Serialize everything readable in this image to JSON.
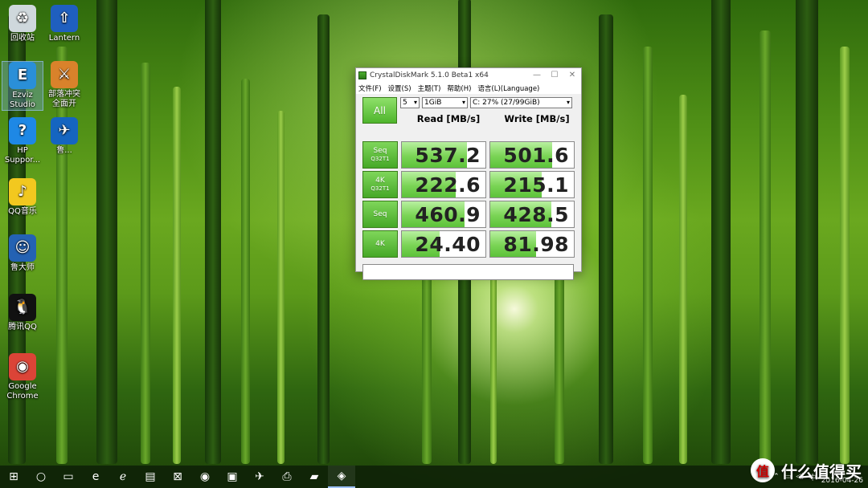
{
  "desktop": {
    "icons": [
      {
        "label": "回收站",
        "icon": "recycle-bin-icon",
        "color": "#cfd8dc"
      },
      {
        "label": "Lantern",
        "icon": "lantern-icon",
        "color": "#1f5fbf"
      },
      {
        "label": "Ezviz Studio",
        "icon": "ezviz-icon",
        "color": "#2a8fd8"
      },
      {
        "label": "部落冲突 全面开",
        "icon": "clash-icon",
        "color": "#d9822b"
      },
      {
        "label": "HP Suppor...",
        "icon": "help-icon",
        "color": "#1e88e5"
      },
      {
        "label": "鲁...",
        "icon": "bird-icon",
        "color": "#1565c0"
      },
      {
        "label": "QQ音乐",
        "icon": "qqmusic-icon",
        "color": "#f2c81f"
      },
      {
        "label": "鲁大师",
        "icon": "ludashi-icon",
        "color": "#2462b3"
      },
      {
        "label": "腾讯QQ",
        "icon": "qq-icon",
        "color": "#111111"
      },
      {
        "label": "Google Chrome",
        "icon": "chrome-icon",
        "color": "#db4437"
      }
    ]
  },
  "window": {
    "title": "CrystalDiskMark 5.1.0 Beta1 x64",
    "controls": {
      "minimize": "—",
      "maximize": "☐",
      "close": "✕"
    },
    "menu": [
      "文件(F)",
      "设置(S)",
      "主题(T)",
      "帮助(H)",
      "语言(L)(Language)"
    ],
    "all_label": "All",
    "count": "5",
    "size": "1GiB",
    "drive": "C: 27% (27/99GiB)",
    "read_header": "Read [MB/s]",
    "write_header": "Write [MB/s]",
    "rows": [
      {
        "label": "Seq",
        "sub": "Q32T1",
        "read": "537.2",
        "write": "501.6",
        "read_pct": 0.78,
        "write_pct": 0.74
      },
      {
        "label": "4K",
        "sub": "Q32T1",
        "read": "222.6",
        "write": "215.1",
        "read_pct": 0.64,
        "write_pct": 0.62
      },
      {
        "label": "Seq",
        "sub": "",
        "read": "460.9",
        "write": "428.5",
        "read_pct": 0.75,
        "write_pct": 0.73
      },
      {
        "label": "4K",
        "sub": "",
        "read": "24.40",
        "write": "81.98",
        "read_pct": 0.45,
        "write_pct": 0.55
      }
    ]
  },
  "taskbar": {
    "items": [
      "windows-start-icon",
      "cortana-icon",
      "task-view-icon",
      "edge-icon",
      "ie-icon",
      "network-icon",
      "store-icon",
      "chrome-icon",
      "remote-desktop-icon",
      "bird-icon",
      "printer-icon",
      "explorer-icon",
      "crystaldiskmark-icon"
    ],
    "date": "2016-04-26"
  },
  "watermark": {
    "symbol": "值",
    "text": "什么值得买"
  }
}
